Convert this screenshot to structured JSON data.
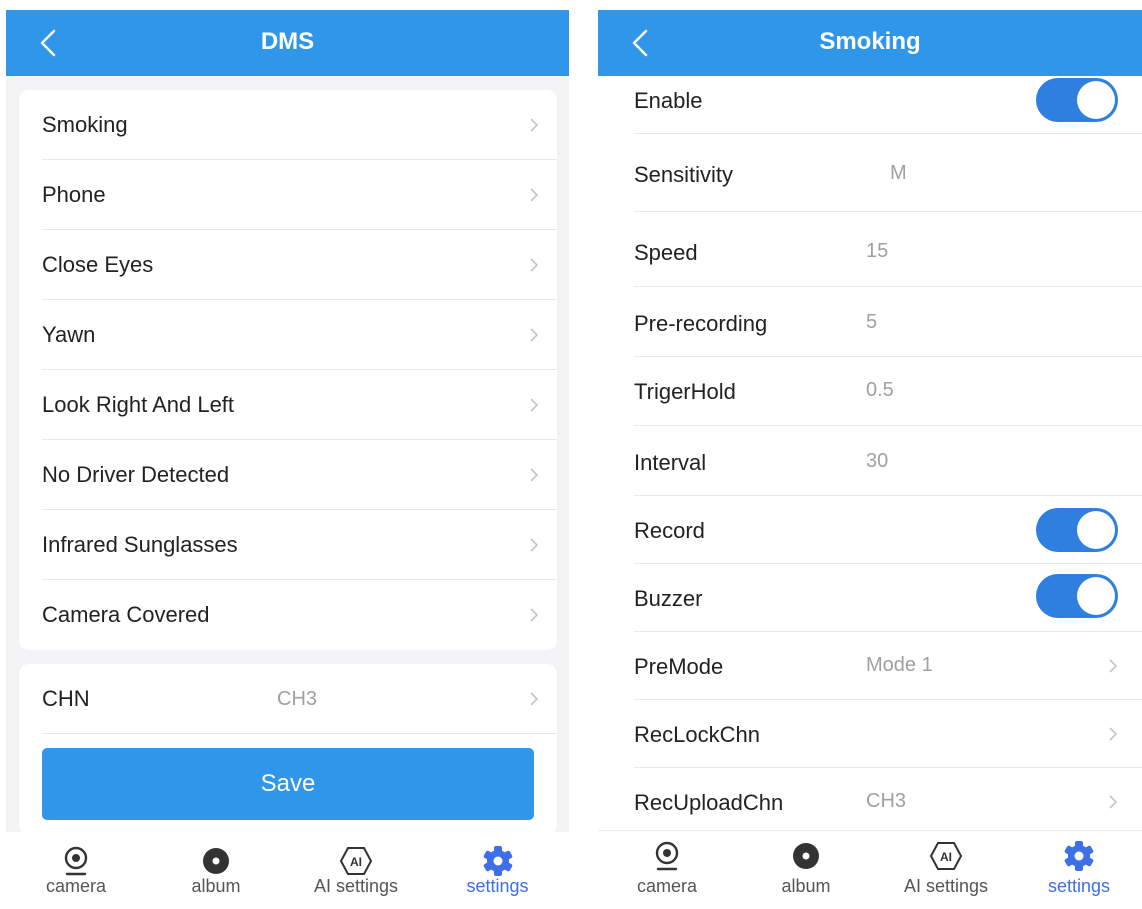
{
  "left": {
    "header": {
      "title": "DMS"
    },
    "menu_items": [
      {
        "label": "Smoking"
      },
      {
        "label": "Phone"
      },
      {
        "label": "Close Eyes"
      },
      {
        "label": "Yawn"
      },
      {
        "label": "Look Right And Left"
      },
      {
        "label": "No Driver Detected"
      },
      {
        "label": "Infrared Sunglasses"
      },
      {
        "label": "Camera Covered"
      }
    ],
    "chn": {
      "label": "CHN",
      "value": "CH3"
    },
    "save_label": "Save"
  },
  "right": {
    "header": {
      "title": "Smoking"
    },
    "settings": {
      "enable": {
        "label": "Enable",
        "on": true
      },
      "sensitivity": {
        "label": "Sensitivity",
        "value": "M"
      },
      "speed": {
        "label": "Speed",
        "value": "15"
      },
      "prerecording": {
        "label": "Pre-recording",
        "value": "5"
      },
      "trigerhold": {
        "label": "TrigerHold",
        "value": "0.5"
      },
      "interval": {
        "label": "Interval",
        "value": "30"
      },
      "record": {
        "label": "Record",
        "on": true
      },
      "buzzer": {
        "label": "Buzzer",
        "on": true
      },
      "premode": {
        "label": "PreMode",
        "value": "Mode 1"
      },
      "reclockchn": {
        "label": "RecLockChn",
        "value": ""
      },
      "recuploadchn": {
        "label": "RecUploadChn",
        "value": "CH3"
      }
    }
  },
  "tabbar": {
    "tabs": [
      {
        "label": "camera",
        "icon": "camera-icon"
      },
      {
        "label": "album",
        "icon": "album-icon"
      },
      {
        "label": "AI settings",
        "icon": "ai-icon"
      },
      {
        "label": "settings",
        "icon": "gear-icon",
        "active": true
      }
    ]
  },
  "colors": {
    "header_blue": "#2f96ea",
    "toggle_blue": "#2f7fe0",
    "active_tab": "#3d6fe6",
    "muted_value": "#a0a0a0"
  }
}
